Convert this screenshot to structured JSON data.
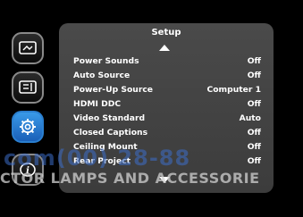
{
  "panel": {
    "title": "Setup",
    "rows": [
      {
        "label": "Power Sounds",
        "value": "Off"
      },
      {
        "label": "Auto Source",
        "value": "Off"
      },
      {
        "label": "Power-Up Source",
        "value": "Computer 1"
      },
      {
        "label": "HDMI DDC",
        "value": "Off"
      },
      {
        "label": "Video Standard",
        "value": "Auto"
      },
      {
        "label": "Closed Captions",
        "value": "Off"
      },
      {
        "label": "Ceiling Mount",
        "value": "Off"
      },
      {
        "label": "Rear Project",
        "value": "Off"
      }
    ]
  },
  "sidebar": {
    "items": [
      {
        "icon": "picture-icon"
      },
      {
        "icon": "settings-list-icon"
      },
      {
        "icon": "gear-icon",
        "active": true
      },
      {
        "icon": "info-icon"
      }
    ]
  },
  "watermark": {
    "line1": "com(00) 28-88",
    "line2": "CTOR LAMPS AND ACCESSORIE"
  },
  "colors": {
    "panel_bg": "#424242",
    "active_accent": "#2a82d8",
    "text": "#ffffff"
  }
}
